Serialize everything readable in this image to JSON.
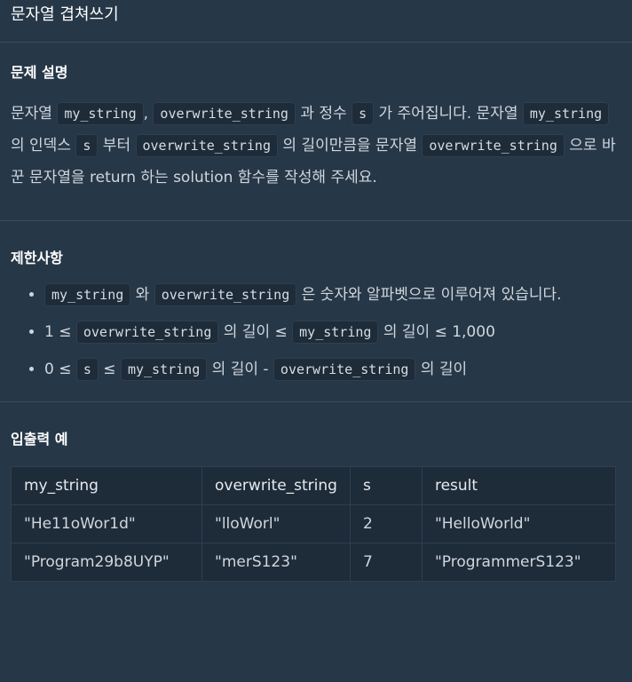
{
  "header": {
    "title": "문자열 겹쳐쓰기"
  },
  "description": {
    "title": "문제 설명",
    "segments": [
      "문자열 ",
      "my_string",
      ", ",
      "overwrite_string",
      " 과 정수 ",
      "s",
      " 가 주어집니다. 문자열 ",
      "my_string",
      " 의 인덱스 ",
      "s",
      " 부터 ",
      "overwrite_string",
      " 의 길이만큼을 문자열 ",
      "overwrite_string",
      " 으로 바꾼 문자열을 return 하는 solution 함수를 작성해 주세요."
    ]
  },
  "constraints": {
    "title": "제한사항",
    "items": [
      [
        "my_string",
        " 와 ",
        "overwrite_string",
        " 은 숫자와 알파벳으로 이루어져 있습니다."
      ],
      [
        "1 ≤ ",
        "overwrite_string",
        " 의 길이 ≤ ",
        "my_string",
        " 의 길이 ≤ 1,000"
      ],
      [
        "0 ≤ ",
        "s",
        " ≤ ",
        "my_string",
        " 의 길이 - ",
        "overwrite_string",
        " 의 길이"
      ]
    ]
  },
  "examples": {
    "title": "입출력 예",
    "headers": [
      "my_string",
      "overwrite_string",
      "s",
      "result"
    ],
    "rows": [
      [
        "\"He11oWor1d\"",
        "\"lloWorl\"",
        "2",
        "\"HelloWorld\""
      ],
      [
        "\"Program29b8UYP\"",
        "\"merS123\"",
        "7",
        "\"ProgrammerS123\""
      ]
    ]
  }
}
